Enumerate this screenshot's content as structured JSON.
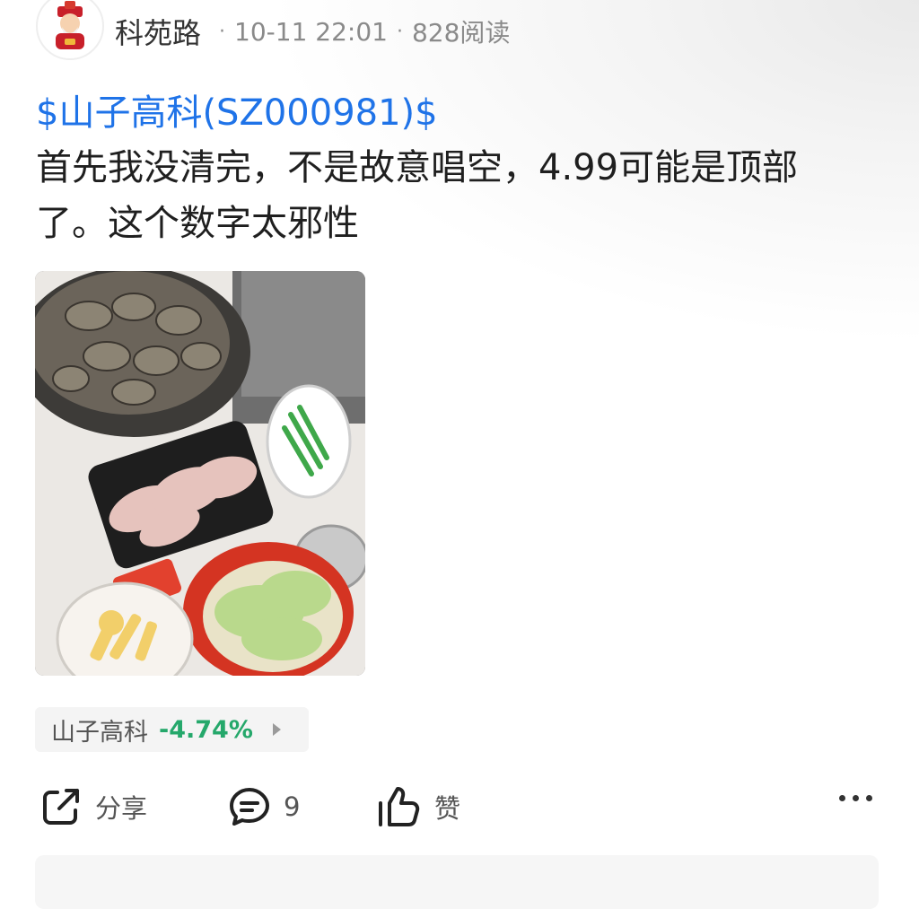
{
  "post": {
    "author": "科苑路",
    "date": "10-11 22:01",
    "reads": "828阅读",
    "stock_tag": "$山子高科(SZ000981)$",
    "text": "首先我没清完，不是故意唱空，4.99可能是顶部了。这个数字太邪性"
  },
  "stock_chip": {
    "name": "山子高科",
    "change": "-4.74%",
    "change_color": "#25a86b"
  },
  "actions": {
    "share_label": "分享",
    "comment_count": "9",
    "like_label": "赞"
  },
  "icons": [
    "share-icon",
    "comment-icon",
    "like-icon",
    "more-icon",
    "arrow-right-icon"
  ],
  "colors": {
    "link": "#1f73e8",
    "down": "#25a86b"
  }
}
